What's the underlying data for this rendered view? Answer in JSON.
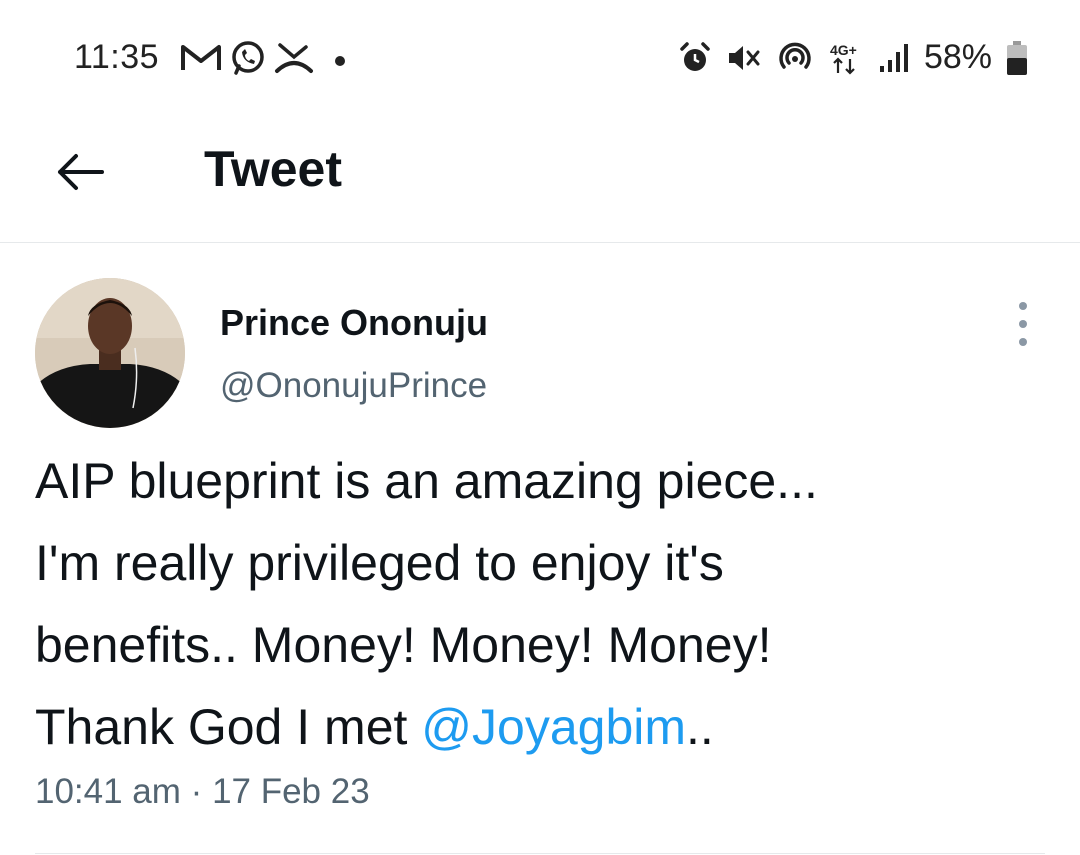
{
  "status_bar": {
    "time": "11:35",
    "battery_pct": "58%",
    "network": "4G+",
    "left_icons": [
      "gmail-icon",
      "whatsapp-icon",
      "missed-call-icon",
      "dot-icon"
    ],
    "right_icons": [
      "alarm-icon",
      "mute-icon",
      "hotspot-icon",
      "network-4g-icon",
      "signal-icon",
      "battery-icon"
    ]
  },
  "header": {
    "title": "Tweet",
    "back_icon": "arrow-left-icon"
  },
  "tweet": {
    "author_name": "Prince Ononuju",
    "author_handle": "@OnonujuPrince",
    "text_lines": [
      "AIP blueprint is an amazing piece...",
      "I'm really privileged to enjoy it's",
      "benefits.. Money! Money! Money!"
    ],
    "last_line_prefix": "Thank God I met ",
    "mention": "@Joyagbim",
    "last_line_suffix": "..",
    "timestamp": "10:41 am",
    "separator": "·",
    "date": "17 Feb 23"
  },
  "colors": {
    "accent": "#1d9bf0",
    "secondary_text": "#536471",
    "primary_text": "#0f1419"
  }
}
